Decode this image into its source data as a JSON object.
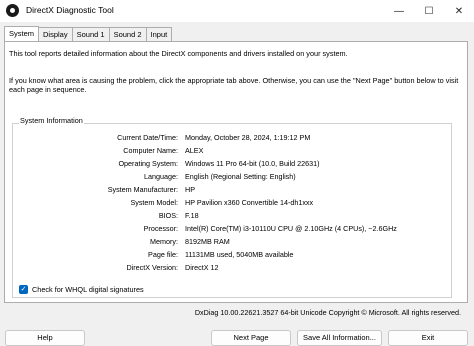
{
  "window": {
    "title": "DirectX Diagnostic Tool",
    "controls": {
      "minimize": "—",
      "maximize": "☐",
      "close": "✕"
    }
  },
  "tabs": [
    {
      "label": "System",
      "active": true
    },
    {
      "label": "Display",
      "active": false
    },
    {
      "label": "Sound 1",
      "active": false
    },
    {
      "label": "Sound 2",
      "active": false
    },
    {
      "label": "Input",
      "active": false
    }
  ],
  "intro": {
    "line1": "This tool reports detailed information about the DirectX components and drivers installed on your system.",
    "line2": "If you know what area is causing the problem, click the appropriate tab above.  Otherwise, you can use the \"Next Page\" button below to visit each page in sequence."
  },
  "system_info": {
    "title": "System Information",
    "rows": [
      {
        "label": "Current Date/Time:",
        "value": "Monday, October 28, 2024, 1:19:12 PM"
      },
      {
        "label": "Computer Name:",
        "value": "ALEX"
      },
      {
        "label": "Operating System:",
        "value": "Windows 11 Pro 64-bit (10.0, Build 22631)"
      },
      {
        "label": "Language:",
        "value": "English (Regional Setting: English)"
      },
      {
        "label": "System Manufacturer:",
        "value": "HP"
      },
      {
        "label": "System Model:",
        "value": "HP Pavilion x360 Convertible 14-dh1xxx"
      },
      {
        "label": "BIOS:",
        "value": "F.18"
      },
      {
        "label": "Processor:",
        "value": "Intel(R) Core(TM) i3-10110U CPU @ 2.10GHz (4 CPUs), ~2.6GHz"
      },
      {
        "label": "Memory:",
        "value": "8192MB RAM"
      },
      {
        "label": "Page file:",
        "value": "11131MB used, 5040MB available"
      },
      {
        "label": "DirectX Version:",
        "value": "DirectX 12"
      }
    ]
  },
  "whql": {
    "label": "Check for WHQL digital signatures",
    "checked": true,
    "check_glyph": "✓"
  },
  "footer": {
    "info": "DxDiag 10.00.22621.3527 64-bit Unicode  Copyright © Microsoft. All rights reserved."
  },
  "buttons": {
    "help": "Help",
    "next_page": "Next Page",
    "save_all": "Save All Information...",
    "exit": "Exit"
  },
  "colors": {
    "accent": "#0067c0",
    "background": "#f0f0f0",
    "panel": "#ffffff"
  }
}
